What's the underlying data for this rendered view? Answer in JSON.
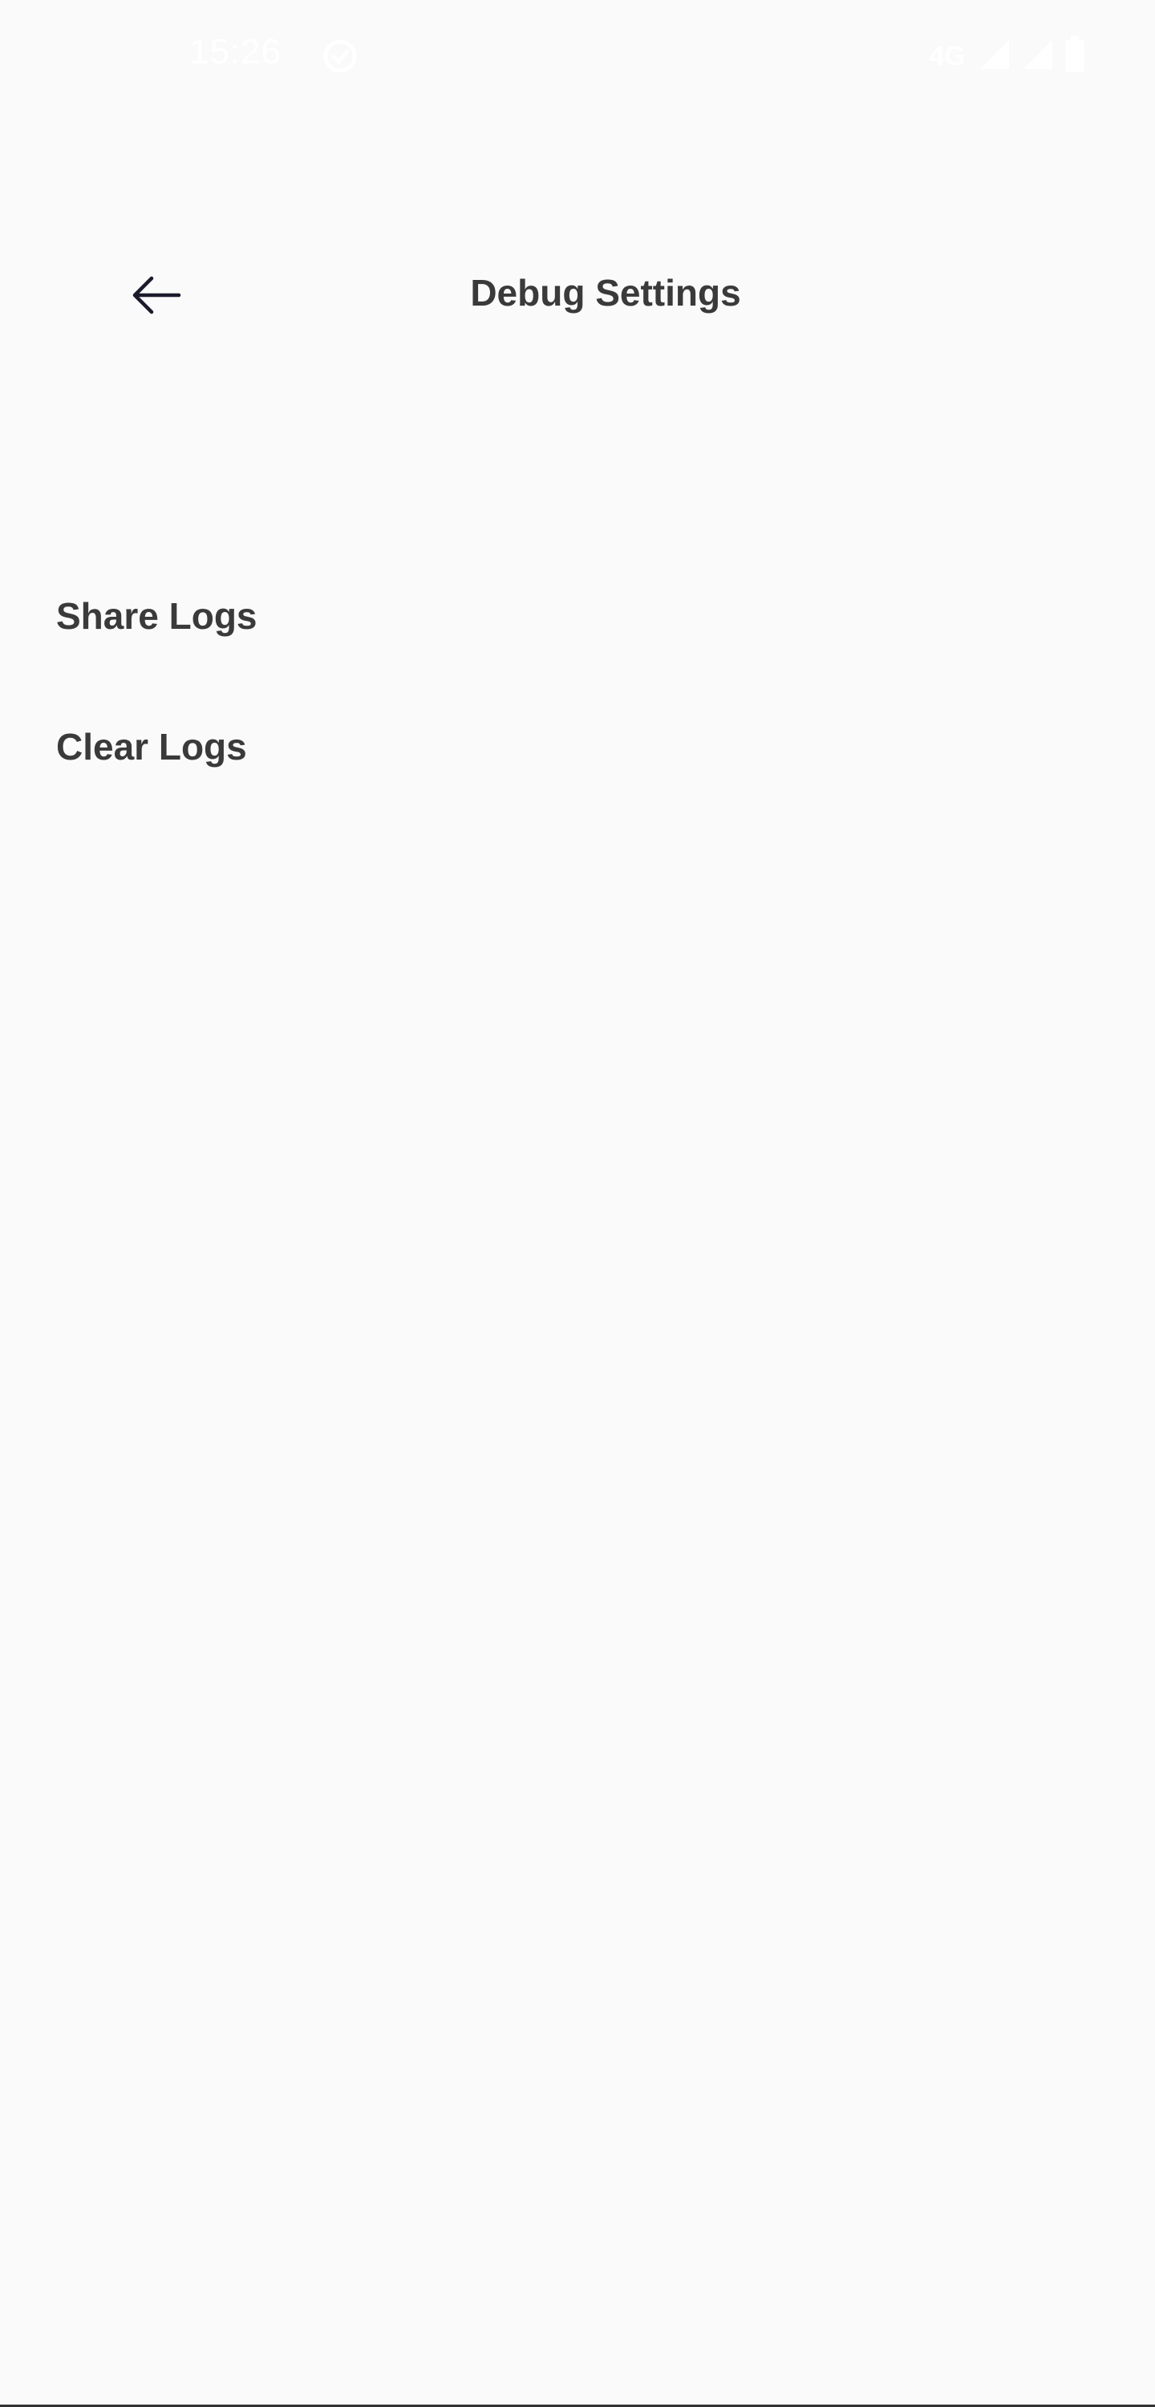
{
  "status_bar": {
    "time": "15:26",
    "network_label": "4G",
    "sync_icon": "sync-check-icon",
    "signal_icon": "cell-signal-icon",
    "battery_icon": "battery-icon"
  },
  "header": {
    "title": "Debug Settings",
    "back_icon": "arrow-left-icon"
  },
  "menu": {
    "items": [
      {
        "label": "Share Logs"
      },
      {
        "label": "Clear Logs"
      }
    ]
  },
  "colors": {
    "background": "#fafafa",
    "text": "#3a3a3a",
    "icon": "#1c1b2e"
  }
}
